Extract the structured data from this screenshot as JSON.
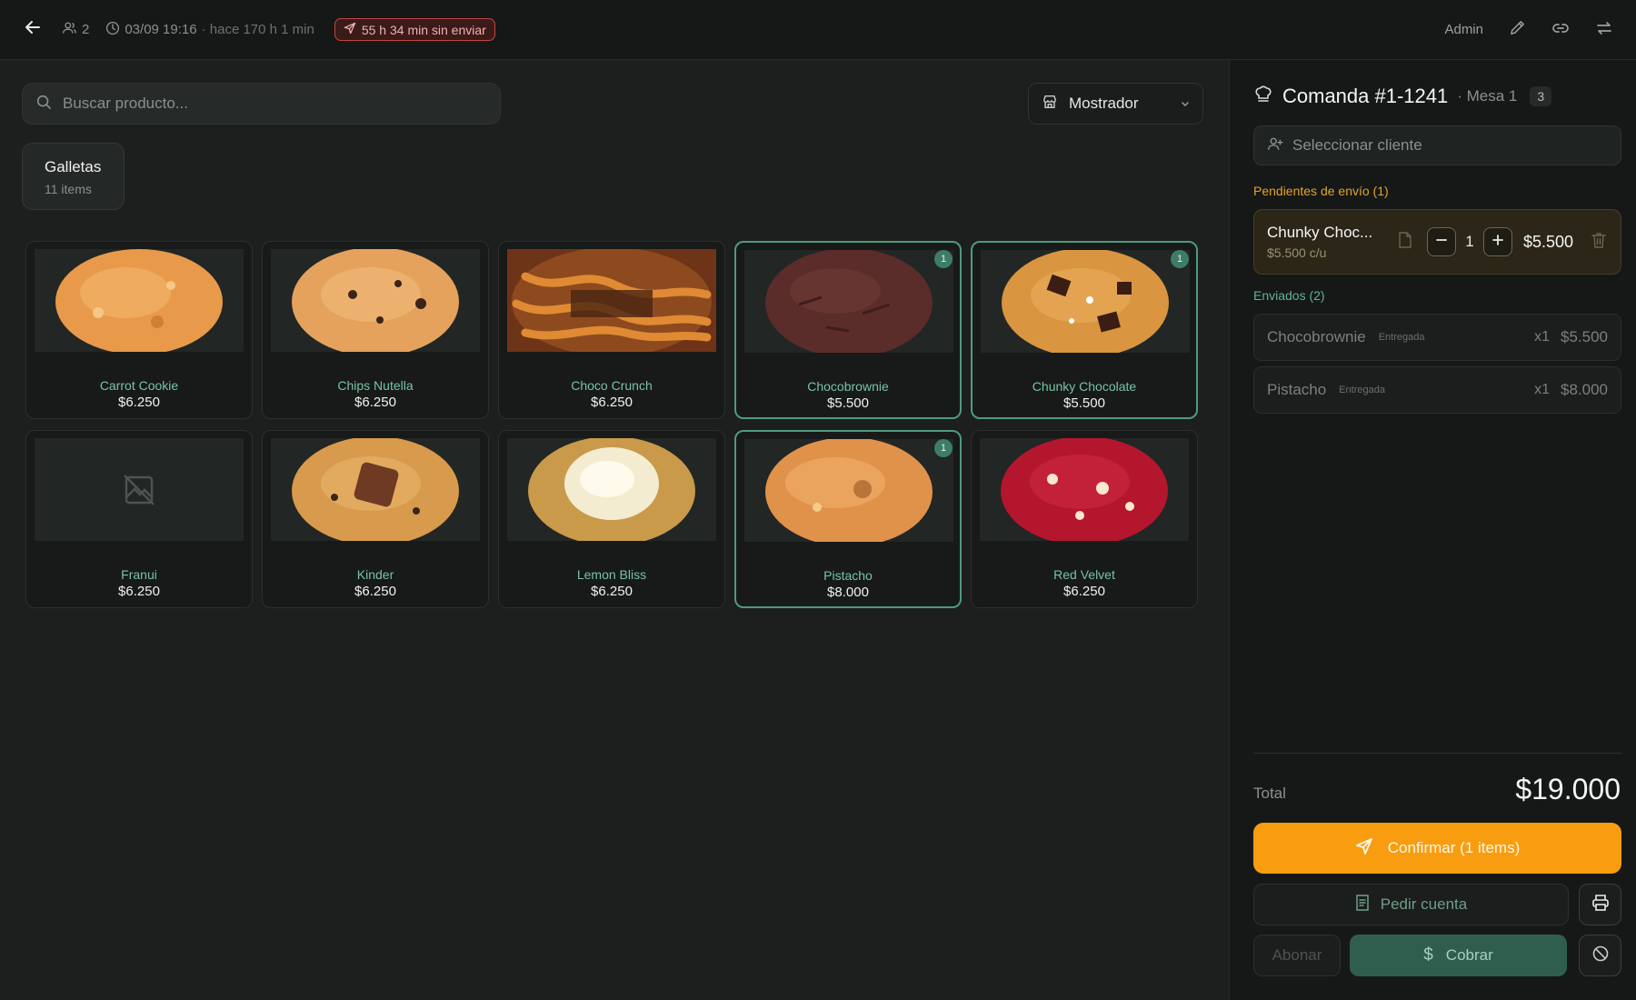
{
  "topbar": {
    "back_icon": "arrow-left-icon",
    "guests": "2",
    "datetime": "03/09 19:16",
    "elapsed": "· hace 170 h 1 min",
    "unsent": "55 h 34 min sin enviar",
    "user": "Admin",
    "icons": [
      "users-icon",
      "clock-icon",
      "send-icon",
      "pencil-icon",
      "link-icon",
      "swap-icon"
    ]
  },
  "search": {
    "placeholder": "Buscar producto..."
  },
  "location": {
    "selected": "Mostrador",
    "icon": "store-icon"
  },
  "category": {
    "name": "Galletas",
    "count": "11 items"
  },
  "products": [
    {
      "name": "Carrot Cookie",
      "price": "$6.250",
      "qty": "",
      "style": "carrot"
    },
    {
      "name": "Chips Nutella",
      "price": "$6.250",
      "qty": "",
      "style": "chips"
    },
    {
      "name": "Choco Crunch",
      "price": "$6.250",
      "qty": "",
      "style": "crunch"
    },
    {
      "name": "Chocobrownie",
      "price": "$5.500",
      "qty": "1",
      "style": "brownie"
    },
    {
      "name": "Chunky Chocolate",
      "price": "$5.500",
      "qty": "1",
      "style": "chunky"
    },
    {
      "name": "Franui",
      "price": "$6.250",
      "qty": "",
      "style": "noimage"
    },
    {
      "name": "Kinder",
      "price": "$6.250",
      "qty": "",
      "style": "kinder"
    },
    {
      "name": "Lemon Bliss",
      "price": "$6.250",
      "qty": "",
      "style": "lemon"
    },
    {
      "name": "Pistacho",
      "price": "$8.000",
      "qty": "1",
      "style": "pistacho"
    },
    {
      "name": "Red Velvet",
      "price": "$6.250",
      "qty": "",
      "style": "redvelvet"
    }
  ],
  "order": {
    "title": "Comanda #1-1241",
    "table": "· Mesa 1",
    "guests": "3",
    "client_placeholder": "Seleccionar cliente",
    "pending_label": "Pendientes de envío (1)",
    "pending": {
      "name": "Chunky Choc...",
      "unit": "$5.500 c/u",
      "qty": "1",
      "price": "$5.500"
    },
    "sent_label": "Enviados (2)",
    "sent": [
      {
        "name": "Chocobrownie",
        "status": "Entregada",
        "qty": "x1",
        "price": "$5.500"
      },
      {
        "name": "Pistacho",
        "status": "Entregada",
        "qty": "x1",
        "price": "$8.000"
      }
    ],
    "total_label": "Total",
    "total": "$19.000",
    "confirm": "Confirmar (1 items)",
    "bill": "Pedir cuenta",
    "abonar": "Abonar",
    "cobrar": "Cobrar"
  },
  "colors": {
    "accent_orange": "#f99d10",
    "accent_green": "#4f9a7e",
    "alert_red": "#c2463f"
  }
}
